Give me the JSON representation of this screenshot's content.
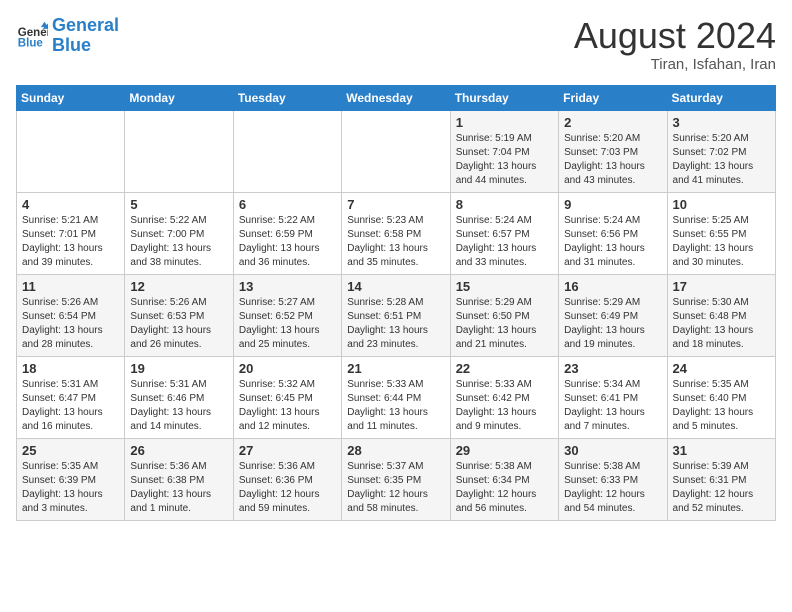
{
  "header": {
    "logo_line1": "General",
    "logo_line2": "Blue",
    "title": "August 2024",
    "subtitle": "Tiran, Isfahan, Iran"
  },
  "weekdays": [
    "Sunday",
    "Monday",
    "Tuesday",
    "Wednesday",
    "Thursday",
    "Friday",
    "Saturday"
  ],
  "weeks": [
    [
      {
        "day": "",
        "info": ""
      },
      {
        "day": "",
        "info": ""
      },
      {
        "day": "",
        "info": ""
      },
      {
        "day": "",
        "info": ""
      },
      {
        "day": "1",
        "info": "Sunrise: 5:19 AM\nSunset: 7:04 PM\nDaylight: 13 hours\nand 44 minutes."
      },
      {
        "day": "2",
        "info": "Sunrise: 5:20 AM\nSunset: 7:03 PM\nDaylight: 13 hours\nand 43 minutes."
      },
      {
        "day": "3",
        "info": "Sunrise: 5:20 AM\nSunset: 7:02 PM\nDaylight: 13 hours\nand 41 minutes."
      }
    ],
    [
      {
        "day": "4",
        "info": "Sunrise: 5:21 AM\nSunset: 7:01 PM\nDaylight: 13 hours\nand 39 minutes."
      },
      {
        "day": "5",
        "info": "Sunrise: 5:22 AM\nSunset: 7:00 PM\nDaylight: 13 hours\nand 38 minutes."
      },
      {
        "day": "6",
        "info": "Sunrise: 5:22 AM\nSunset: 6:59 PM\nDaylight: 13 hours\nand 36 minutes."
      },
      {
        "day": "7",
        "info": "Sunrise: 5:23 AM\nSunset: 6:58 PM\nDaylight: 13 hours\nand 35 minutes."
      },
      {
        "day": "8",
        "info": "Sunrise: 5:24 AM\nSunset: 6:57 PM\nDaylight: 13 hours\nand 33 minutes."
      },
      {
        "day": "9",
        "info": "Sunrise: 5:24 AM\nSunset: 6:56 PM\nDaylight: 13 hours\nand 31 minutes."
      },
      {
        "day": "10",
        "info": "Sunrise: 5:25 AM\nSunset: 6:55 PM\nDaylight: 13 hours\nand 30 minutes."
      }
    ],
    [
      {
        "day": "11",
        "info": "Sunrise: 5:26 AM\nSunset: 6:54 PM\nDaylight: 13 hours\nand 28 minutes."
      },
      {
        "day": "12",
        "info": "Sunrise: 5:26 AM\nSunset: 6:53 PM\nDaylight: 13 hours\nand 26 minutes."
      },
      {
        "day": "13",
        "info": "Sunrise: 5:27 AM\nSunset: 6:52 PM\nDaylight: 13 hours\nand 25 minutes."
      },
      {
        "day": "14",
        "info": "Sunrise: 5:28 AM\nSunset: 6:51 PM\nDaylight: 13 hours\nand 23 minutes."
      },
      {
        "day": "15",
        "info": "Sunrise: 5:29 AM\nSunset: 6:50 PM\nDaylight: 13 hours\nand 21 minutes."
      },
      {
        "day": "16",
        "info": "Sunrise: 5:29 AM\nSunset: 6:49 PM\nDaylight: 13 hours\nand 19 minutes."
      },
      {
        "day": "17",
        "info": "Sunrise: 5:30 AM\nSunset: 6:48 PM\nDaylight: 13 hours\nand 18 minutes."
      }
    ],
    [
      {
        "day": "18",
        "info": "Sunrise: 5:31 AM\nSunset: 6:47 PM\nDaylight: 13 hours\nand 16 minutes."
      },
      {
        "day": "19",
        "info": "Sunrise: 5:31 AM\nSunset: 6:46 PM\nDaylight: 13 hours\nand 14 minutes."
      },
      {
        "day": "20",
        "info": "Sunrise: 5:32 AM\nSunset: 6:45 PM\nDaylight: 13 hours\nand 12 minutes."
      },
      {
        "day": "21",
        "info": "Sunrise: 5:33 AM\nSunset: 6:44 PM\nDaylight: 13 hours\nand 11 minutes."
      },
      {
        "day": "22",
        "info": "Sunrise: 5:33 AM\nSunset: 6:42 PM\nDaylight: 13 hours\nand 9 minutes."
      },
      {
        "day": "23",
        "info": "Sunrise: 5:34 AM\nSunset: 6:41 PM\nDaylight: 13 hours\nand 7 minutes."
      },
      {
        "day": "24",
        "info": "Sunrise: 5:35 AM\nSunset: 6:40 PM\nDaylight: 13 hours\nand 5 minutes."
      }
    ],
    [
      {
        "day": "25",
        "info": "Sunrise: 5:35 AM\nSunset: 6:39 PM\nDaylight: 13 hours\nand 3 minutes."
      },
      {
        "day": "26",
        "info": "Sunrise: 5:36 AM\nSunset: 6:38 PM\nDaylight: 13 hours\nand 1 minute."
      },
      {
        "day": "27",
        "info": "Sunrise: 5:36 AM\nSunset: 6:36 PM\nDaylight: 12 hours\nand 59 minutes."
      },
      {
        "day": "28",
        "info": "Sunrise: 5:37 AM\nSunset: 6:35 PM\nDaylight: 12 hours\nand 58 minutes."
      },
      {
        "day": "29",
        "info": "Sunrise: 5:38 AM\nSunset: 6:34 PM\nDaylight: 12 hours\nand 56 minutes."
      },
      {
        "day": "30",
        "info": "Sunrise: 5:38 AM\nSunset: 6:33 PM\nDaylight: 12 hours\nand 54 minutes."
      },
      {
        "day": "31",
        "info": "Sunrise: 5:39 AM\nSunset: 6:31 PM\nDaylight: 12 hours\nand 52 minutes."
      }
    ]
  ]
}
